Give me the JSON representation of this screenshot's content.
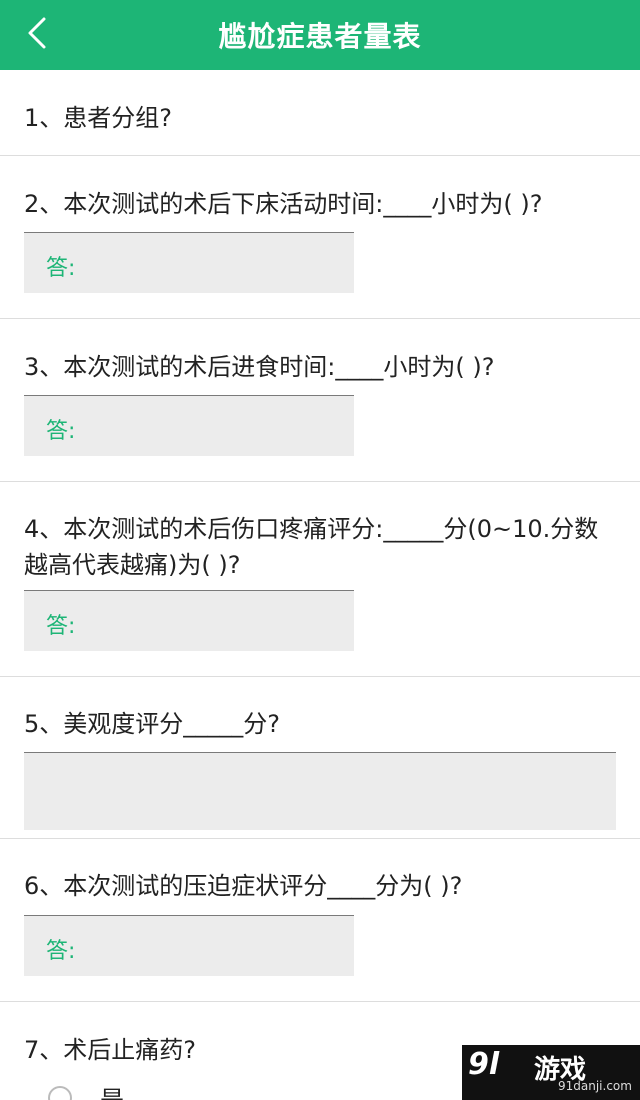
{
  "header": {
    "title": "尴尬症患者量表",
    "back_icon": "chevron-left-icon",
    "color": "#1db576"
  },
  "questions": [
    {
      "text": "1、患者分组?"
    },
    {
      "text": "2、本次测试的术后下床活动时间:____小时为(    )?",
      "answer_label": "答:"
    },
    {
      "text": "3、本次测试的术后进食时间:____小时为(    )?",
      "answer_label": "答:"
    },
    {
      "text": "4、本次测试的术后伤口疼痛评分:_____分(0~10.分数越高代表越痛)为(    )?",
      "answer_label": "答:"
    },
    {
      "text": "5、美观度评分_____分?"
    },
    {
      "text": "6、本次测试的压迫症状评分____分为(    )?",
      "answer_label": "答:"
    },
    {
      "text": "7、术后止痛药?",
      "options": [
        "是"
      ]
    }
  ],
  "watermark": {
    "number": "9l",
    "text": "游戏",
    "domain": "91danji.com"
  }
}
